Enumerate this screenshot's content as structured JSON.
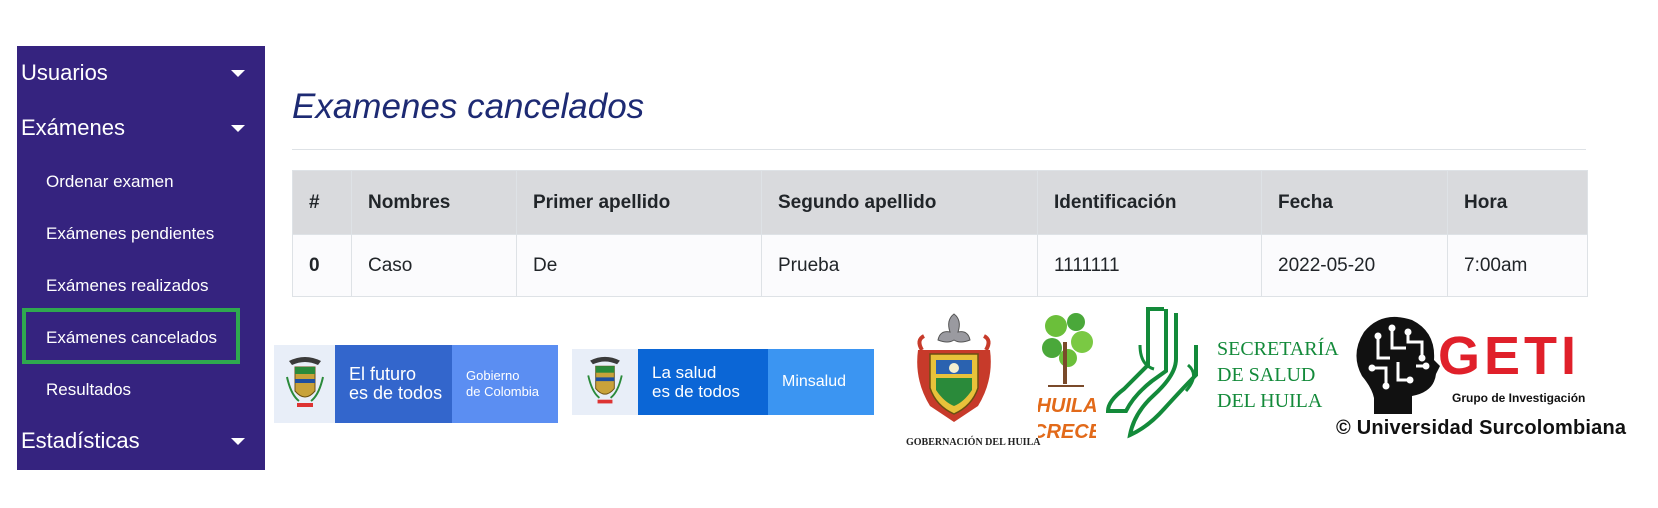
{
  "sidebar": {
    "menus": [
      {
        "label": "Usuarios"
      },
      {
        "label": "Exámenes"
      },
      {
        "label": "Estadísticas"
      }
    ],
    "examenes_items": [
      {
        "label": "Ordenar examen"
      },
      {
        "label": "Exámenes pendientes"
      },
      {
        "label": "Exámenes realizados"
      },
      {
        "label": "Exámenes cancelados"
      },
      {
        "label": "Resultados"
      }
    ],
    "active_item": "Exámenes cancelados"
  },
  "main": {
    "title": "Examenes cancelados",
    "table": {
      "headers": [
        "#",
        "Nombres",
        "Primer apellido",
        "Segundo apellido",
        "Identificación",
        "Fecha",
        "Hora"
      ],
      "rows": [
        [
          "0",
          "Caso",
          "De",
          "Prueba",
          "1111111",
          "2022-05-20",
          "7:00am"
        ]
      ]
    }
  },
  "footer_logos": {
    "gobierno": {
      "slogan_line1": "El futuro",
      "slogan_line2": "es de todos",
      "brand_line1": "Gobierno",
      "brand_line2": "de Colombia"
    },
    "minsalud": {
      "slogan_line1": "La salud",
      "slogan_line2": "es de todos",
      "brand": "Minsalud"
    },
    "gobernacion": {
      "caption": "GOBERNACIÓN DEL HUILA"
    },
    "huila_crece": {
      "line1": "HUILA",
      "line2": "CRECE"
    },
    "secretaria": {
      "line1": "SECRETARÍA",
      "line2": "DE SALUD",
      "line3": "DEL HUILA"
    },
    "geti": {
      "name": "GETI",
      "subtitle": "Grupo de Investigación",
      "university": "© Universidad Surcolombiana"
    }
  },
  "colors": {
    "sidebar_bg": "#35237f",
    "title": "#1d2a73",
    "active_outline": "#2fa84f",
    "table_header_bg": "#d9dadd",
    "gobierno_dark": "#3366cc",
    "gobierno_light": "#5b8ef2",
    "minsalud_dark": "#0b66d6",
    "minsalud_light": "#3b95f2",
    "secretaria_green": "#138a3a",
    "geti_red": "#e0202a"
  }
}
